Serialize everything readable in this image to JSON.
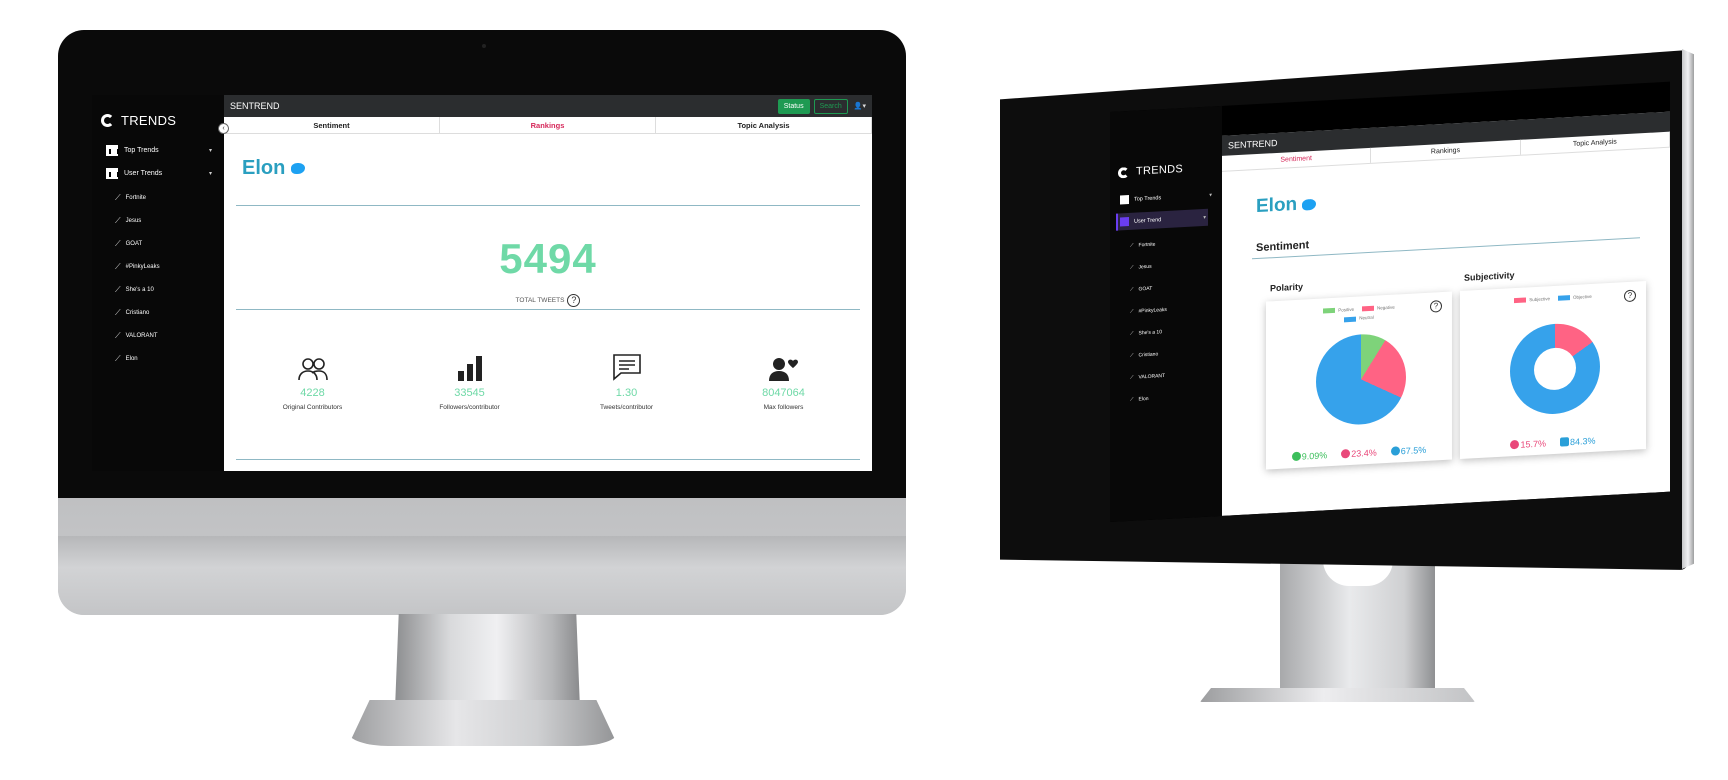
{
  "sidebar": {
    "brand": "TRENDS",
    "top_trends": "Top Trends",
    "user_trends": "User Trends",
    "user_trend": "User Trend",
    "items": [
      "Fortnite",
      "Jesus",
      "GOAT",
      "#PinkyLeaks",
      "She's a 10",
      "Cristiano",
      "VALORANT",
      "Elon"
    ]
  },
  "header": {
    "app_name": "SENTREND",
    "status_label": "Status",
    "search_label": "Search"
  },
  "tabs": [
    "Sentiment",
    "Rankings",
    "Topic Analysis"
  ],
  "rankings": {
    "user": "Elon",
    "total_tweets": "5494",
    "total_tweets_label": "TOTAL TWEETS",
    "help": "?",
    "stats": [
      {
        "icon": "users-icon",
        "value": "4228",
        "label": "Original Contributors"
      },
      {
        "icon": "bar-chart-icon",
        "value": "33545",
        "label": "Followers/contributor"
      },
      {
        "icon": "chat-icon",
        "value": "1.30",
        "label": "Tweets/contributor"
      },
      {
        "icon": "user-heart-icon",
        "value": "8047064",
        "label": "Max followers"
      }
    ]
  },
  "sentiment": {
    "user": "Elon",
    "section": "Sentiment",
    "polarity": {
      "title": "Polarity",
      "legend": [
        {
          "name": "Positive",
          "color": "#7ed37a"
        },
        {
          "name": "Negative",
          "color": "#ff6384"
        },
        {
          "name": "Neutral",
          "color": "#36a2eb"
        }
      ],
      "percents": [
        "9.09%",
        "23.4%",
        "67.5%"
      ],
      "values": [
        9.09,
        23.4,
        67.5
      ]
    },
    "subjectivity": {
      "title": "Subjectivity",
      "legend": [
        {
          "name": "Subjective",
          "color": "#ff6384"
        },
        {
          "name": "Objective",
          "color": "#36a2eb"
        }
      ],
      "percents": [
        "15.7%",
        "84.3%"
      ],
      "values": [
        15.7,
        84.3
      ]
    }
  }
}
